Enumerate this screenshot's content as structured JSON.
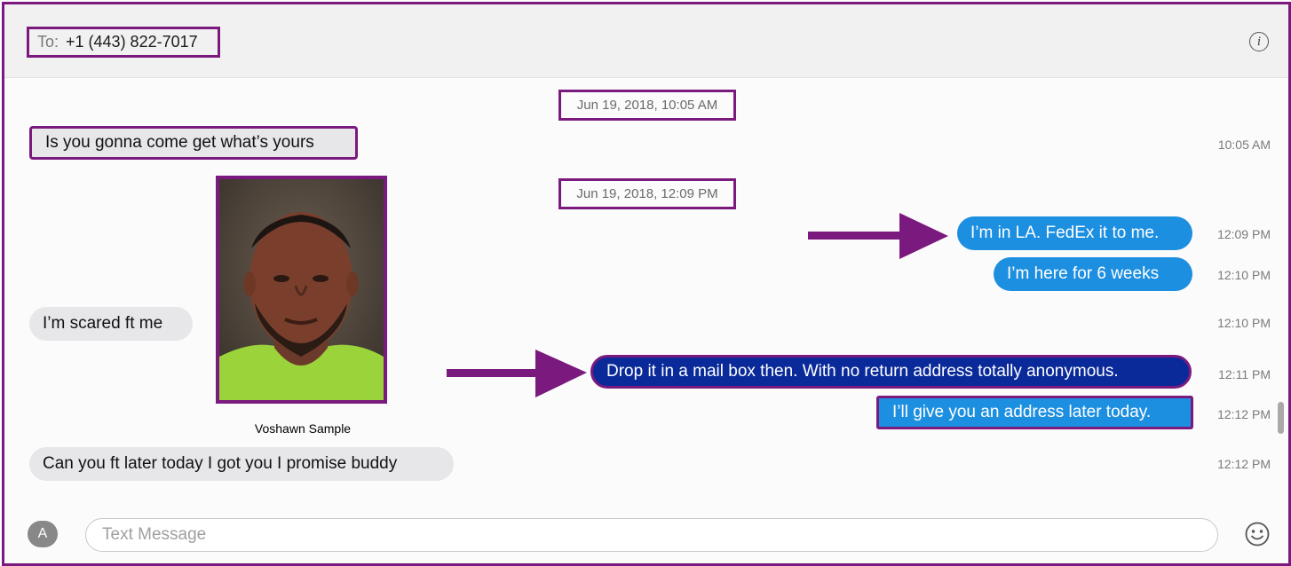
{
  "header": {
    "to_label": "To:",
    "recipient": "+1 (443) 822-7017",
    "info_icon": "info-circle-icon"
  },
  "timestamps": {
    "first": "Jun 19, 2018, 10:05 AM",
    "second": "Jun 19, 2018, 12:09 PM"
  },
  "messages": [
    {
      "text": "Is you gonna come get what’s yours",
      "time": "10:05 AM",
      "direction": "received"
    },
    {
      "text": "I’m in LA.  FedEx it to me.",
      "time": "12:09 PM",
      "direction": "sent"
    },
    {
      "text": "I’m here for 6 weeks",
      "time": "12:10 PM",
      "direction": "sent"
    },
    {
      "text": "I’m scared ft me",
      "time": "12:10 PM",
      "direction": "received"
    },
    {
      "text": "Drop it in a mail box then. With no return address totally anonymous.",
      "time": "12:11 PM",
      "direction": "sent"
    },
    {
      "text": "I’ll give you an address later today.",
      "time": "12:12 PM",
      "direction": "sent"
    },
    {
      "text": "Can you ft later today I got you I promise buddy",
      "time": "12:12 PM",
      "direction": "received"
    }
  ],
  "photo": {
    "caption": "Voshawn Sample"
  },
  "composer": {
    "placeholder": "Text Message",
    "apps_icon": "app-store-icon",
    "emoji_icon": "emoji-icon"
  },
  "colors": {
    "annotation": "#7b1a7e",
    "sent_bubble": "#1d8fe0",
    "highlighted_bubble": "#0a2a9a",
    "received_bubble": "#e7e7ea"
  }
}
